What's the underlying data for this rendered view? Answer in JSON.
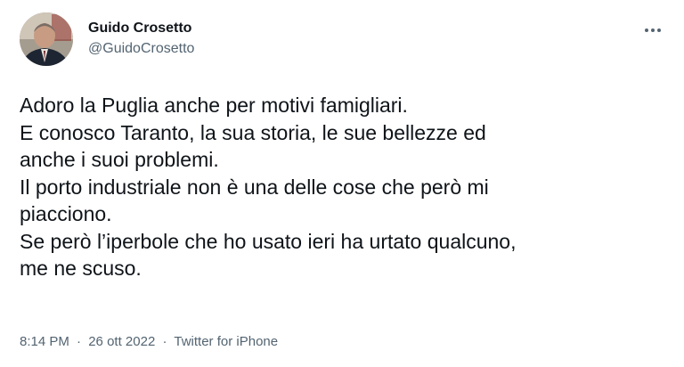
{
  "author": {
    "display_name": "Guido Crosetto",
    "handle": "@GuidoCrosetto"
  },
  "tweet": {
    "lines": [
      "Adoro la Puglia anche per motivi famigliari.",
      "E conosco Taranto, la sua storia, le sue bellezze ed",
      "anche i suoi problemi.",
      "Il porto industriale non è una delle cose che però mi",
      "piacciono.",
      "Se però l’iperbole che ho usato ieri ha urtato qualcuno,",
      "me ne scuso."
    ],
    "time": "8:14 PM",
    "date": "26 ott 2022",
    "separator": "·",
    "source": "Twitter for iPhone"
  },
  "icons": {
    "more": "more-horizontal-icon"
  },
  "colors": {
    "text": "#0f1419",
    "secondary": "#536471"
  }
}
